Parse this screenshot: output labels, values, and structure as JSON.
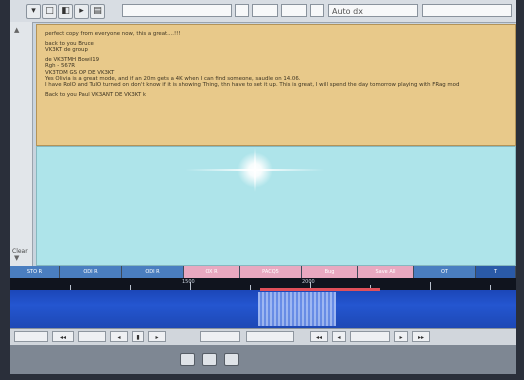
{
  "toolbar": {
    "icons": [
      "▾",
      "□",
      "◧",
      "▸",
      "▤"
    ],
    "fields": [
      "",
      "",
      "",
      "",
      "",
      "",
      ""
    ],
    "right_field_text": "Auto dx"
  },
  "sidebar": {
    "scroll_up": "▲",
    "scroll_down": "▼",
    "label": "Clear"
  },
  "rx_text": {
    "lines": [
      "perfect copy from everyone now, this a great....!!!",
      "",
      "back to you Bruce",
      "VK3KT de group",
      "",
      "de VK3TMH  Bowil19",
      "   Rgh - 567R",
      "VK3TDM GS OP DE VK3KT",
      "Yes Olivia is a great mode, and if an 20m gets a 4K when I can find someone, saudle on 14.06.",
      "I have RoIO and TuIO turned on don't know if it is showing Thing, thn have to set it up. This is great, I will spend the day tomorrow playing with FRag mod",
      "",
      "Back to you Paul VK3ANT DE VK3KT k"
    ]
  },
  "band_bar": {
    "segments": [
      {
        "label": "STO R",
        "color": "#4a7ec0"
      },
      {
        "label": "ODI R",
        "color": "#4a7ec0"
      },
      {
        "label": "ODI R",
        "color": "#4a7ec0"
      },
      {
        "label": "OX R",
        "color": "#e8a8c0"
      },
      {
        "label": "PACQ5",
        "color": "#e8a8c0"
      },
      {
        "label": "Bug",
        "color": "#e8a8c0"
      },
      {
        "label": "Save All",
        "color": "#e8a8c0"
      },
      {
        "label": "OT",
        "color": "#4a7ec0"
      },
      {
        "label": "T",
        "color": "#2a5aa8"
      }
    ]
  },
  "ruler_labels": [
    "1500",
    "2000"
  ],
  "controls": {
    "labels": [
      "",
      "◂◂",
      "",
      "◂",
      "▮",
      "▸",
      "",
      "",
      "◂◂",
      "◂",
      "",
      "▸",
      "▸▸"
    ]
  }
}
